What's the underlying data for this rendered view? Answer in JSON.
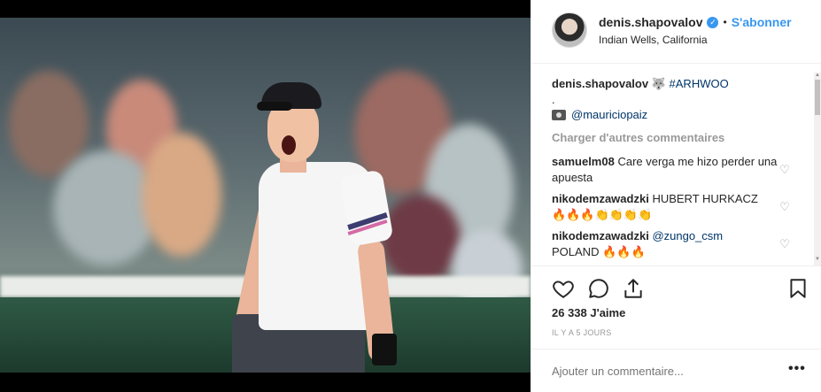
{
  "post": {
    "username": "denis.shapovalov",
    "verified_icon": "verified-badge-icon",
    "follow_label": "S'abonner",
    "location": "Indian Wells, California",
    "caption": {
      "username": "denis.shapovalov",
      "emoji": "🐺",
      "hashtag": "#ARHWOO",
      "dot": ".",
      "camera_emoji": "📷",
      "mention": "@mauriciopaiz"
    },
    "load_more_label": "Charger d'autres commentaires",
    "comments": [
      {
        "username": "samuelm08",
        "text": "Care verga me hizo perder una apuesta"
      },
      {
        "username": "nikodemzawadzki",
        "text": "HUBERT HURKACZ",
        "text2": "🔥🔥🔥👏👏👏👏"
      },
      {
        "username": "nikodemzawadzki",
        "mention": "@zungo_csm",
        "text2": "POLAND 🔥🔥🔥"
      }
    ],
    "likes": "26 338 J'aime",
    "date": "IL Y A 5 JOURS",
    "add_comment_placeholder": "Ajouter un commentaire...",
    "more_label": "•••"
  },
  "colors": {
    "accent": "#3897f0",
    "text": "#262626",
    "muted": "#999999",
    "border": "#efefef"
  }
}
